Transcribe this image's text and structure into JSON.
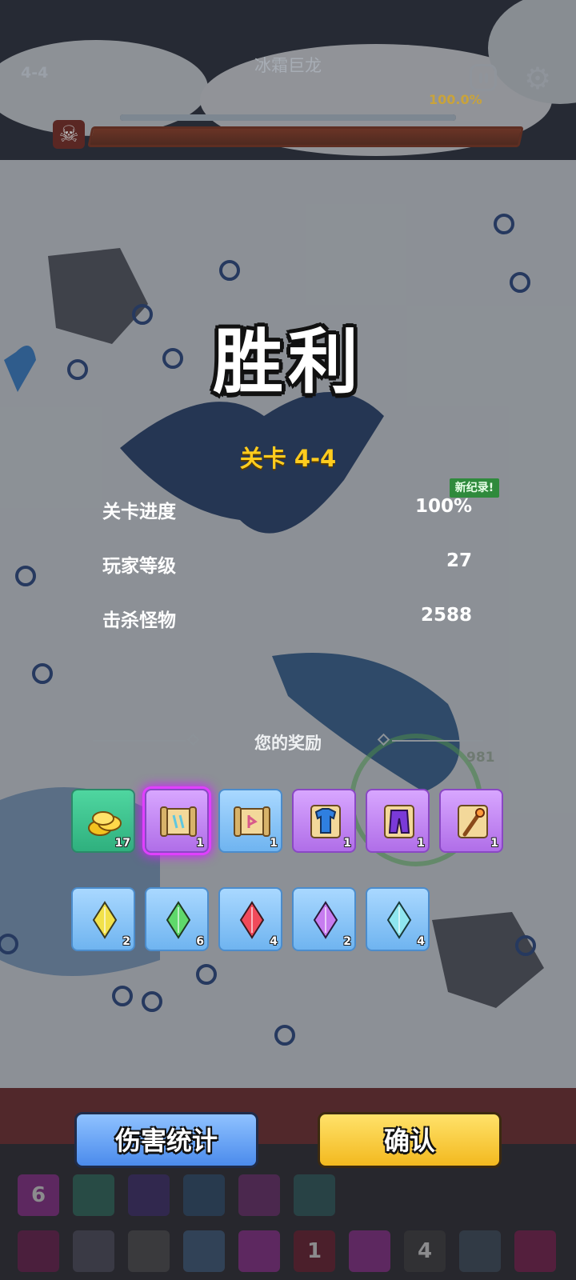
{
  "hud": {
    "level": "4-4",
    "boss_name": "冰霜巨龙",
    "boss_hp_percent_text": "100.0%",
    "boss_hp_fraction": 1.0,
    "pause_icon": "pause-icon",
    "settings_icon": "gear-icon"
  },
  "result": {
    "title": "胜利",
    "stage_label": "关卡 4-4",
    "new_record_badge": "新纪录!",
    "stats": [
      {
        "label": "关卡进度",
        "value": "100%"
      },
      {
        "label": "玩家等级",
        "value": "27"
      },
      {
        "label": "击杀怪物",
        "value": "2588"
      }
    ]
  },
  "rewards": {
    "title": "您的奖励",
    "row1": [
      {
        "icon": "gold-coins-icon",
        "count": "17",
        "rarity": "green"
      },
      {
        "icon": "scroll-icon",
        "count": "1",
        "rarity": "purple",
        "selected": true
      },
      {
        "icon": "rune-scroll-icon",
        "count": "1",
        "rarity": "blue"
      },
      {
        "icon": "blue-armor-icon",
        "count": "1",
        "rarity": "purple"
      },
      {
        "icon": "purple-pants-icon",
        "count": "1",
        "rarity": "purple"
      },
      {
        "icon": "staff-icon",
        "count": "1",
        "rarity": "purple"
      }
    ],
    "row2": [
      {
        "icon": "yellow-gem-icon",
        "count": "2",
        "color": "#f2e14a"
      },
      {
        "icon": "green-gem-icon",
        "count": "6",
        "color": "#5fd86b"
      },
      {
        "icon": "red-gem-icon",
        "count": "4",
        "color": "#f04a5a"
      },
      {
        "icon": "purple-gem-icon",
        "count": "2",
        "color": "#c77cf0"
      },
      {
        "icon": "cyan-gem-icon",
        "count": "4",
        "color": "#8fe6ef"
      }
    ]
  },
  "enemy_hp_text": "981",
  "buttons": {
    "damage_stats": "伤害统计",
    "confirm": "确认"
  },
  "skill_bar": {
    "row1_labels": [
      "6",
      "",
      "",
      "",
      "",
      ""
    ],
    "row2_labels": [
      "",
      "",
      "",
      "",
      "",
      "1",
      "",
      "4",
      "",
      ""
    ]
  }
}
